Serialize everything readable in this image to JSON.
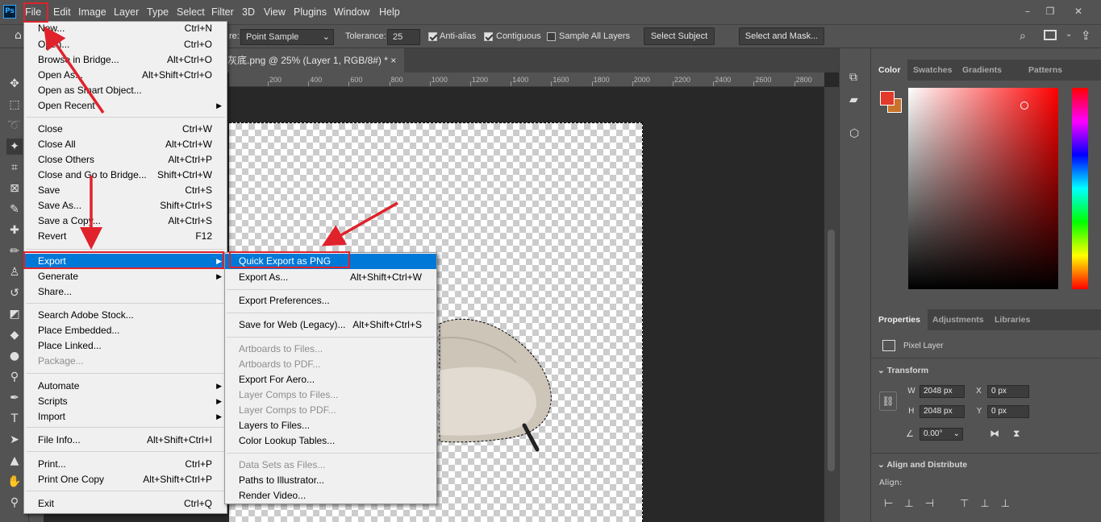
{
  "app": {
    "logo": "Ps"
  },
  "menubar": [
    "File",
    "Edit",
    "Image",
    "Layer",
    "Type",
    "Select",
    "Filter",
    "3D",
    "View",
    "Plugins",
    "Window",
    "Help"
  ],
  "window_controls": {
    "minimize": "–",
    "restore": "❐",
    "close": "✕"
  },
  "options": {
    "sample_label": "re:",
    "sample_value": "Point Sample",
    "tolerance_label": "Tolerance:",
    "tolerance_value": "25",
    "anti_alias": "Anti-alias",
    "contiguous": "Contiguous",
    "sample_all": "Sample All Layers",
    "select_subject": "Select Subject",
    "select_mask": "Select and Mask..."
  },
  "document": {
    "tab_title": "灰底.png @ 25% (Layer 1, RGB/8#) *",
    "close": "×"
  },
  "ruler_ticks": [
    "200",
    "400",
    "600",
    "800",
    "1000",
    "1200",
    "1400",
    "1600",
    "1800",
    "2000",
    "2200",
    "2400",
    "2600",
    "2800"
  ],
  "file_menu": [
    {
      "label": "New...",
      "shortcut": "Ctrl+N"
    },
    {
      "label": "Open...",
      "shortcut": "Ctrl+O"
    },
    {
      "label": "Browse in Bridge...",
      "shortcut": "Alt+Ctrl+O"
    },
    {
      "label": "Open As...",
      "shortcut": "Alt+Shift+Ctrl+O"
    },
    {
      "label": "Open as Smart Object...",
      "shortcut": ""
    },
    {
      "label": "Open Recent",
      "shortcut": "",
      "sub": true
    },
    {
      "label": "Close",
      "shortcut": "Ctrl+W"
    },
    {
      "label": "Close All",
      "shortcut": "Alt+Ctrl+W"
    },
    {
      "label": "Close Others",
      "shortcut": "Alt+Ctrl+P"
    },
    {
      "label": "Close and Go to Bridge...",
      "shortcut": "Shift+Ctrl+W"
    },
    {
      "label": "Save",
      "shortcut": "Ctrl+S"
    },
    {
      "label": "Save As...",
      "shortcut": "Shift+Ctrl+S"
    },
    {
      "label": "Save a Copy...",
      "shortcut": "Alt+Ctrl+S"
    },
    {
      "label": "Revert",
      "shortcut": "F12"
    },
    {
      "label": "Export",
      "shortcut": "",
      "sub": true,
      "highlight": true
    },
    {
      "label": "Generate",
      "shortcut": "",
      "sub": true
    },
    {
      "label": "Share...",
      "shortcut": ""
    },
    {
      "label": "Search Adobe Stock...",
      "shortcut": ""
    },
    {
      "label": "Place Embedded...",
      "shortcut": ""
    },
    {
      "label": "Place Linked...",
      "shortcut": ""
    },
    {
      "label": "Package...",
      "shortcut": "",
      "disabled": true
    },
    {
      "label": "Automate",
      "shortcut": "",
      "sub": true
    },
    {
      "label": "Scripts",
      "shortcut": "",
      "sub": true
    },
    {
      "label": "Import",
      "shortcut": "",
      "sub": true
    },
    {
      "label": "File Info...",
      "shortcut": "Alt+Shift+Ctrl+I"
    },
    {
      "label": "Print...",
      "shortcut": "Ctrl+P"
    },
    {
      "label": "Print One Copy",
      "shortcut": "Alt+Shift+Ctrl+P"
    },
    {
      "label": "Exit",
      "shortcut": "Ctrl+Q"
    }
  ],
  "export_menu": [
    {
      "label": "Quick Export as PNG",
      "shortcut": "",
      "highlight": true
    },
    {
      "label": "Export As...",
      "shortcut": "Alt+Shift+Ctrl+W"
    },
    {
      "label": "Export Preferences...",
      "shortcut": ""
    },
    {
      "label": "Save for Web (Legacy)...",
      "shortcut": "Alt+Shift+Ctrl+S"
    },
    {
      "label": "Artboards to Files...",
      "shortcut": "",
      "disabled": true
    },
    {
      "label": "Artboards to PDF...",
      "shortcut": "",
      "disabled": true
    },
    {
      "label": "Export For Aero...",
      "shortcut": ""
    },
    {
      "label": "Layer Comps to Files...",
      "shortcut": "",
      "disabled": true
    },
    {
      "label": "Layer Comps to PDF...",
      "shortcut": "",
      "disabled": true
    },
    {
      "label": "Layers to Files...",
      "shortcut": ""
    },
    {
      "label": "Color Lookup Tables...",
      "shortcut": ""
    },
    {
      "label": "Data Sets as Files...",
      "shortcut": "",
      "disabled": true
    },
    {
      "label": "Paths to Illustrator...",
      "shortcut": ""
    },
    {
      "label": "Render Video...",
      "shortcut": ""
    }
  ],
  "color_panel": {
    "tabs": [
      "Color",
      "Swatches",
      "Gradients",
      "Patterns"
    ],
    "fg": "#e23a2b",
    "bg": "#c8722a"
  },
  "properties": {
    "tabs": [
      "Properties",
      "Adjustments",
      "Libraries"
    ],
    "type": "Pixel Layer",
    "transform": "Transform",
    "w_label": "W",
    "w": "2048 px",
    "h_label": "H",
    "h": "2048 px",
    "x_label": "X",
    "x": "0 px",
    "y_label": "Y",
    "y": "0 px",
    "angle": "0.00°",
    "align_section": "Align and Distribute",
    "align_label": "Align:"
  }
}
